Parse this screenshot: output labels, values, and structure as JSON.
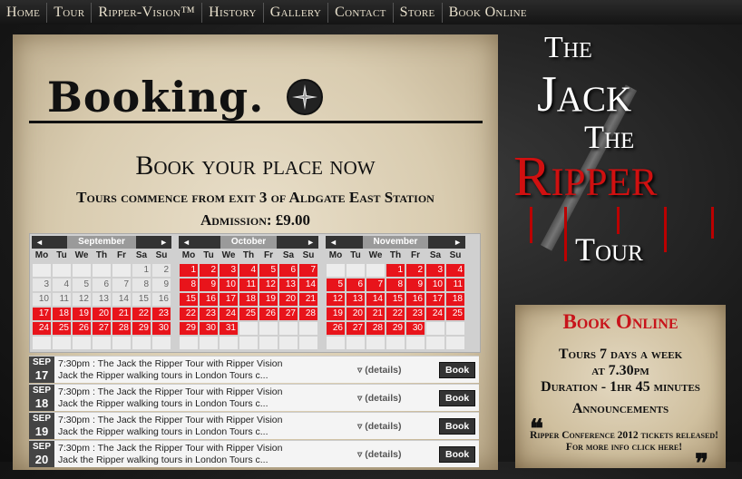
{
  "nav": {
    "items": [
      "Home",
      "Tour",
      "Ripper-Vision™",
      "History",
      "Gallery",
      "Contact",
      "Store",
      "Book Online"
    ]
  },
  "booking": {
    "title": "Booking.",
    "headline": "Book your place now",
    "subline": "Tours commence from exit 3 of Aldgate East Station",
    "admission": "Admission: £9.00"
  },
  "calendar": {
    "prev_symbol": "◄",
    "next_symbol": "►",
    "dow": [
      "Mo",
      "Tu",
      "We",
      "Th",
      "Fr",
      "Sa",
      "Su"
    ],
    "months": [
      {
        "name": "September",
        "cells": [
          {
            "d": "",
            "s": "empty"
          },
          {
            "d": "",
            "s": "empty"
          },
          {
            "d": "",
            "s": "empty"
          },
          {
            "d": "",
            "s": "empty"
          },
          {
            "d": "",
            "s": "empty"
          },
          {
            "d": "1",
            "s": "past"
          },
          {
            "d": "2",
            "s": "past"
          },
          {
            "d": "3",
            "s": "past"
          },
          {
            "d": "4",
            "s": "past"
          },
          {
            "d": "5",
            "s": "past"
          },
          {
            "d": "6",
            "s": "past"
          },
          {
            "d": "7",
            "s": "past"
          },
          {
            "d": "8",
            "s": "past"
          },
          {
            "d": "9",
            "s": "past"
          },
          {
            "d": "10",
            "s": "past"
          },
          {
            "d": "11",
            "s": "past"
          },
          {
            "d": "12",
            "s": "past"
          },
          {
            "d": "13",
            "s": "past"
          },
          {
            "d": "14",
            "s": "past"
          },
          {
            "d": "15",
            "s": "past"
          },
          {
            "d": "16",
            "s": "past"
          },
          {
            "d": "17",
            "s": "avail"
          },
          {
            "d": "18",
            "s": "avail"
          },
          {
            "d": "19",
            "s": "avail"
          },
          {
            "d": "20",
            "s": "avail"
          },
          {
            "d": "21",
            "s": "avail"
          },
          {
            "d": "22",
            "s": "avail"
          },
          {
            "d": "23",
            "s": "avail"
          },
          {
            "d": "24",
            "s": "avail"
          },
          {
            "d": "25",
            "s": "avail"
          },
          {
            "d": "26",
            "s": "avail"
          },
          {
            "d": "27",
            "s": "avail"
          },
          {
            "d": "28",
            "s": "avail"
          },
          {
            "d": "29",
            "s": "avail"
          },
          {
            "d": "30",
            "s": "avail"
          },
          {
            "d": "",
            "s": "empty"
          },
          {
            "d": "",
            "s": "empty"
          },
          {
            "d": "",
            "s": "empty"
          },
          {
            "d": "",
            "s": "empty"
          },
          {
            "d": "",
            "s": "empty"
          },
          {
            "d": "",
            "s": "empty"
          },
          {
            "d": "",
            "s": "empty"
          }
        ]
      },
      {
        "name": "October",
        "cells": [
          {
            "d": "1",
            "s": "avail"
          },
          {
            "d": "2",
            "s": "avail"
          },
          {
            "d": "3",
            "s": "avail"
          },
          {
            "d": "4",
            "s": "avail"
          },
          {
            "d": "5",
            "s": "avail"
          },
          {
            "d": "6",
            "s": "avail"
          },
          {
            "d": "7",
            "s": "avail"
          },
          {
            "d": "8",
            "s": "avail"
          },
          {
            "d": "9",
            "s": "avail"
          },
          {
            "d": "10",
            "s": "avail"
          },
          {
            "d": "11",
            "s": "avail"
          },
          {
            "d": "12",
            "s": "avail"
          },
          {
            "d": "13",
            "s": "avail"
          },
          {
            "d": "14",
            "s": "avail"
          },
          {
            "d": "15",
            "s": "avail"
          },
          {
            "d": "16",
            "s": "avail"
          },
          {
            "d": "17",
            "s": "avail"
          },
          {
            "d": "18",
            "s": "avail"
          },
          {
            "d": "19",
            "s": "avail"
          },
          {
            "d": "20",
            "s": "avail"
          },
          {
            "d": "21",
            "s": "avail"
          },
          {
            "d": "22",
            "s": "avail"
          },
          {
            "d": "23",
            "s": "avail"
          },
          {
            "d": "24",
            "s": "avail"
          },
          {
            "d": "25",
            "s": "avail"
          },
          {
            "d": "26",
            "s": "avail"
          },
          {
            "d": "27",
            "s": "avail"
          },
          {
            "d": "28",
            "s": "avail"
          },
          {
            "d": "29",
            "s": "avail"
          },
          {
            "d": "30",
            "s": "avail"
          },
          {
            "d": "31",
            "s": "avail"
          },
          {
            "d": "",
            "s": "empty"
          },
          {
            "d": "",
            "s": "empty"
          },
          {
            "d": "",
            "s": "empty"
          },
          {
            "d": "",
            "s": "empty"
          },
          {
            "d": "",
            "s": "empty"
          },
          {
            "d": "",
            "s": "empty"
          },
          {
            "d": "",
            "s": "empty"
          },
          {
            "d": "",
            "s": "empty"
          },
          {
            "d": "",
            "s": "empty"
          },
          {
            "d": "",
            "s": "empty"
          },
          {
            "d": "",
            "s": "empty"
          }
        ]
      },
      {
        "name": "November",
        "cells": [
          {
            "d": "",
            "s": "empty"
          },
          {
            "d": "",
            "s": "empty"
          },
          {
            "d": "",
            "s": "empty"
          },
          {
            "d": "1",
            "s": "avail"
          },
          {
            "d": "2",
            "s": "avail"
          },
          {
            "d": "3",
            "s": "avail"
          },
          {
            "d": "4",
            "s": "avail"
          },
          {
            "d": "5",
            "s": "avail"
          },
          {
            "d": "6",
            "s": "avail"
          },
          {
            "d": "7",
            "s": "avail"
          },
          {
            "d": "8",
            "s": "avail"
          },
          {
            "d": "9",
            "s": "avail"
          },
          {
            "d": "10",
            "s": "avail"
          },
          {
            "d": "11",
            "s": "avail"
          },
          {
            "d": "12",
            "s": "avail"
          },
          {
            "d": "13",
            "s": "avail"
          },
          {
            "d": "14",
            "s": "avail"
          },
          {
            "d": "15",
            "s": "avail"
          },
          {
            "d": "16",
            "s": "avail"
          },
          {
            "d": "17",
            "s": "avail"
          },
          {
            "d": "18",
            "s": "avail"
          },
          {
            "d": "19",
            "s": "avail"
          },
          {
            "d": "20",
            "s": "avail"
          },
          {
            "d": "21",
            "s": "avail"
          },
          {
            "d": "22",
            "s": "avail"
          },
          {
            "d": "23",
            "s": "avail"
          },
          {
            "d": "24",
            "s": "avail"
          },
          {
            "d": "25",
            "s": "avail"
          },
          {
            "d": "26",
            "s": "avail"
          },
          {
            "d": "27",
            "s": "avail"
          },
          {
            "d": "28",
            "s": "avail"
          },
          {
            "d": "29",
            "s": "avail"
          },
          {
            "d": "30",
            "s": "avail"
          },
          {
            "d": "",
            "s": "empty"
          },
          {
            "d": "",
            "s": "empty"
          },
          {
            "d": "",
            "s": "empty"
          },
          {
            "d": "",
            "s": "empty"
          },
          {
            "d": "",
            "s": "empty"
          },
          {
            "d": "",
            "s": "empty"
          },
          {
            "d": "",
            "s": "empty"
          },
          {
            "d": "",
            "s": "empty"
          },
          {
            "d": "",
            "s": "empty"
          }
        ]
      }
    ]
  },
  "events": [
    {
      "mon": "SEP",
      "day": "17",
      "line1": "7:30pm : The Jack the Ripper Tour with Ripper Vision",
      "line2": "Jack the Ripper walking tours in London Tours c...",
      "details": "(details)",
      "book": "Book"
    },
    {
      "mon": "SEP",
      "day": "18",
      "line1": "7:30pm : The Jack the Ripper Tour with Ripper Vision",
      "line2": "Jack the Ripper walking tours in London Tours c...",
      "details": "(details)",
      "book": "Book"
    },
    {
      "mon": "SEP",
      "day": "19",
      "line1": "7:30pm : The Jack the Ripper Tour with Ripper Vision",
      "line2": "Jack the Ripper walking tours in London Tours c...",
      "details": "(details)",
      "book": "Book"
    },
    {
      "mon": "SEP",
      "day": "20",
      "line1": "7:30pm : The Jack the Ripper Tour with Ripper Vision",
      "line2": "Jack the Ripper walking tours in London Tours c...",
      "details": "(details)",
      "book": "Book"
    }
  ],
  "logo": {
    "the1": "The",
    "jack": "Jack",
    "the2": "The",
    "ripper": "Ripper",
    "tour": "Tour"
  },
  "side_panel": {
    "title": "Book Online",
    "line1": "Tours 7 days a week",
    "line2": "at 7.30pm",
    "line3": "Duration - 1hr 45 minutes",
    "line4": "Announcements",
    "announcement": "Ripper Conference 2012 tickets released! For more info click here!",
    "open_quote": "❝",
    "close_quote": "❞"
  },
  "colors": {
    "accent_red": "#e8141b",
    "dark": "#333333"
  }
}
